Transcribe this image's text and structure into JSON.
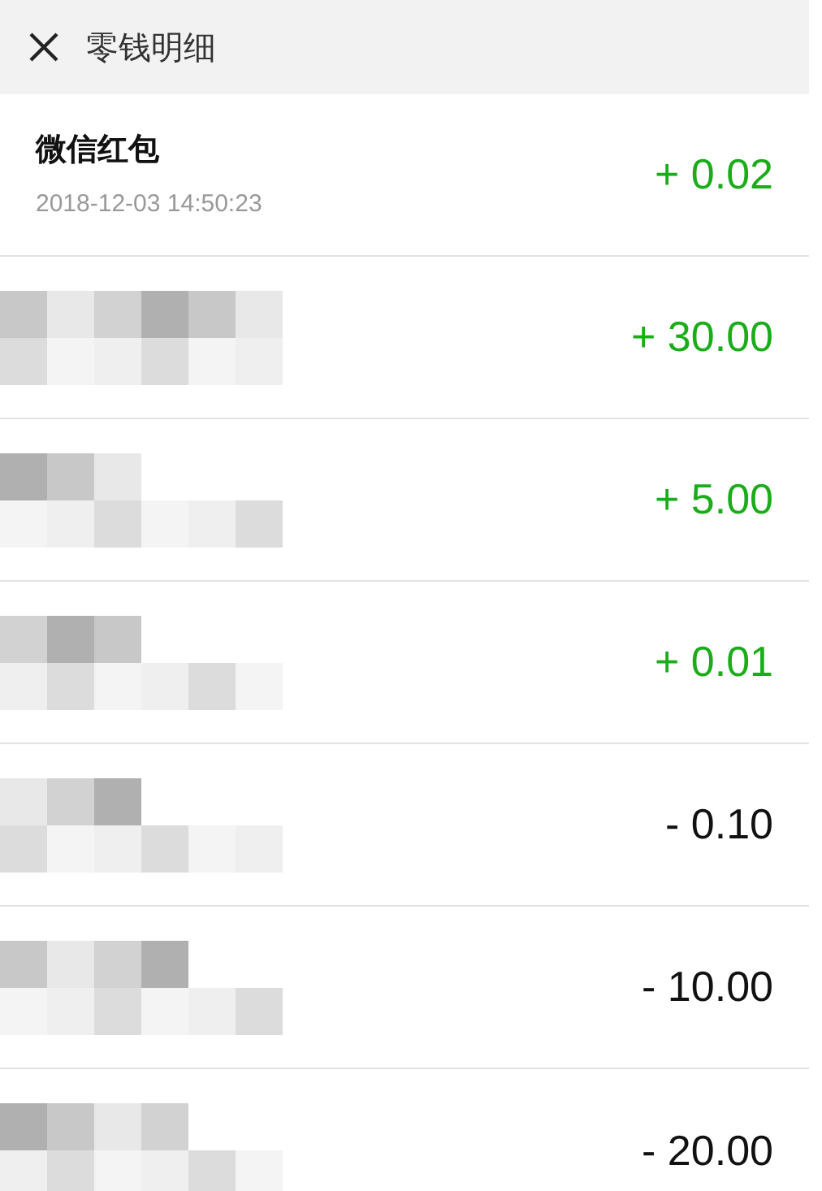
{
  "header": {
    "title": "零钱明细"
  },
  "transactions": [
    {
      "redacted": false,
      "name": "微信红包",
      "time": "2018-12-03 14:50:23",
      "kind": "income",
      "amount": "+ 0.02"
    },
    {
      "redacted": true,
      "kind": "income",
      "amount": "+ 30.00"
    },
    {
      "redacted": true,
      "kind": "income",
      "amount": "+ 5.00"
    },
    {
      "redacted": true,
      "kind": "income",
      "amount": "+ 0.01"
    },
    {
      "redacted": true,
      "kind": "expense",
      "amount": "- 0.10"
    },
    {
      "redacted": true,
      "kind": "expense",
      "amount": "- 10.00"
    },
    {
      "redacted": true,
      "kind": "expense",
      "amount": "- 20.00"
    }
  ]
}
